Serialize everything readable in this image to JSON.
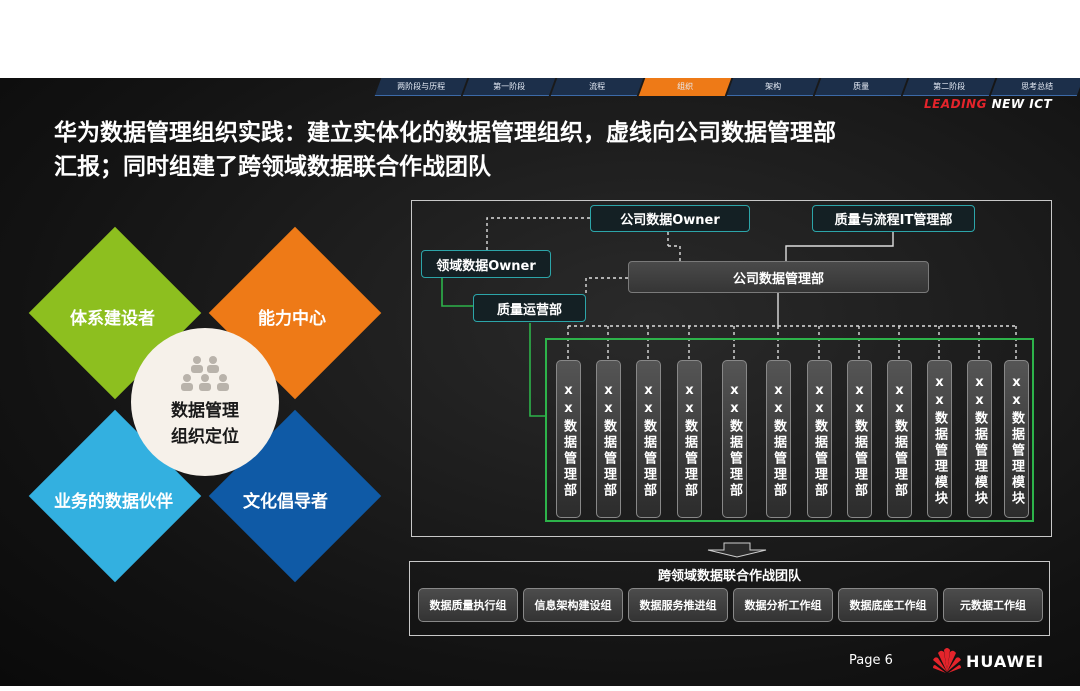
{
  "nav": {
    "tabs": [
      {
        "label": "两阶段与历程",
        "active": false
      },
      {
        "label": "第一阶段",
        "active": false
      },
      {
        "label": "流程",
        "active": false
      },
      {
        "label": "组织",
        "active": true
      },
      {
        "label": "架构",
        "active": false
      },
      {
        "label": "质量",
        "active": false
      },
      {
        "label": "第二阶段",
        "active": false
      },
      {
        "label": "思考总结",
        "active": false
      }
    ]
  },
  "brand_tag": {
    "lead": "LEADING",
    "rest": " NEW ICT"
  },
  "title": {
    "line1": "华为数据管理组织实践：建立实体化的数据管理组织，虚线向公司数据管理部",
    "line2": "汇报；同时组建了跨领域数据联合作战团队"
  },
  "diamond": {
    "top_left": "体系建设者",
    "top_right": "能力中心",
    "bottom_left": "业务的数据伙伴",
    "bottom_right": "文化倡导者",
    "center_line1": "数据管理",
    "center_line2": "组织定位",
    "colors": {
      "top_left": "#8dbf1f",
      "top_right": "#ee7a17",
      "bottom_left": "#33b0e0",
      "bottom_right": "#0f5aa6"
    }
  },
  "org": {
    "company_owner": "公司数据Owner",
    "quality_it": "质量与流程IT管理部",
    "domain_owner": "领域数据Owner",
    "company_dept": "公司数据管理部",
    "quality_ops": "质量运营部",
    "departments": [
      "xx数据管理部",
      "xx数据管理部",
      "xx数据管理部",
      "xx数据管理部",
      "xx数据管理部",
      "xx数据管理部",
      "xx数据管理部",
      "xx数据管理部",
      "xx数据管理部",
      "xx数据管理模块",
      "xx数据管理模块",
      "xx数据管理模块"
    ]
  },
  "team": {
    "title": "跨领域数据联合作战团队",
    "groups": [
      "数据质量执行组",
      "信息架构建设组",
      "数据服务推进组",
      "数据分析工作组",
      "数据底座工作组",
      "元数据工作组"
    ]
  },
  "footer": {
    "page": "Page 6",
    "brand": "HUAWEI",
    "logo_icon": "huawei-petal-logo-icon"
  }
}
